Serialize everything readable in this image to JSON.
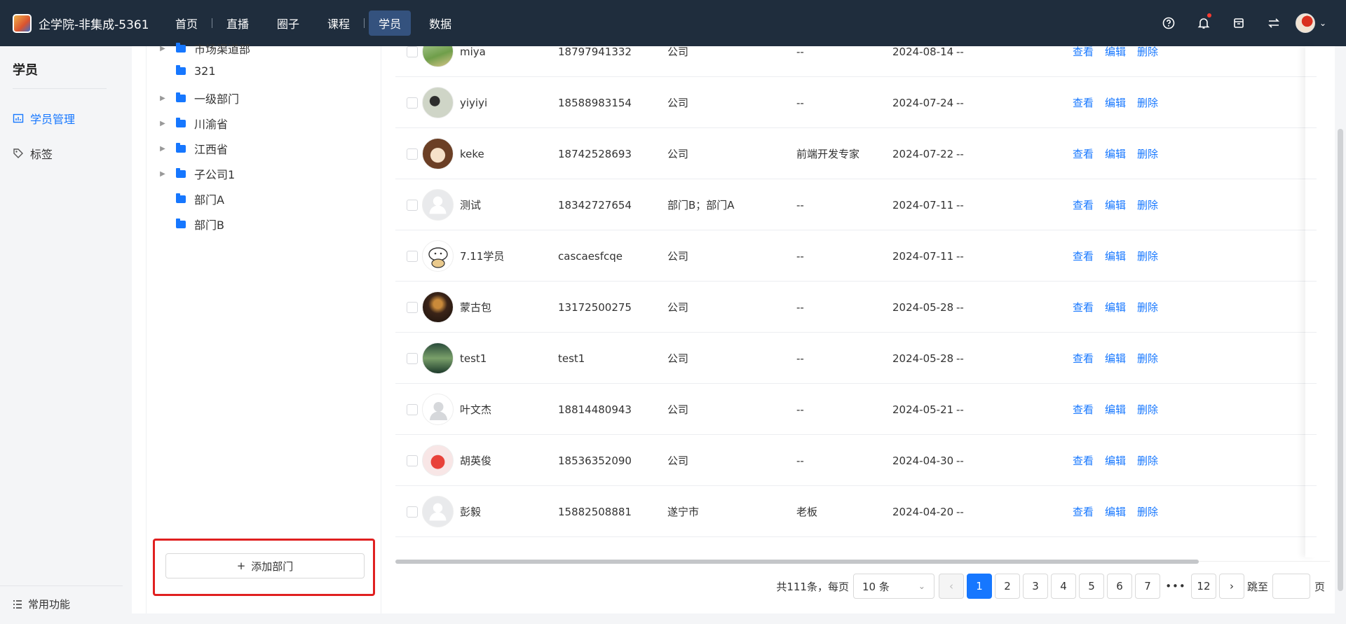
{
  "header": {
    "brand": "企学院-非集成-5361",
    "nav": [
      "首页",
      "直播",
      "圈子",
      "课程",
      "学员",
      "数据"
    ],
    "active_nav": "学员"
  },
  "sidebar": {
    "title": "学员",
    "items": [
      {
        "label": "学员管理",
        "icon": "chart-icon",
        "active": true
      },
      {
        "label": "标签",
        "icon": "tag-icon",
        "active": false
      }
    ],
    "bottom": "常用功能"
  },
  "tree": {
    "nodes": [
      {
        "label": "市场渠道部",
        "expandable": true
      },
      {
        "label": "321",
        "expandable": false
      },
      {
        "label": "一级部门",
        "expandable": true
      },
      {
        "label": "川渝省",
        "expandable": true
      },
      {
        "label": "江西省",
        "expandable": true
      },
      {
        "label": "子公司1",
        "expandable": true
      },
      {
        "label": "部门A",
        "expandable": false
      },
      {
        "label": "部门B",
        "expandable": false
      }
    ],
    "add_button": "添加部门",
    "add_symbol": "+"
  },
  "table": {
    "actions": [
      "查看",
      "编辑",
      "删除"
    ],
    "rows": [
      {
        "name": "miya",
        "phone": "18797941332",
        "dept": "公司",
        "title": "--",
        "date": "2024-08-14",
        "extra": "--",
        "avatar": "av-miya"
      },
      {
        "name": "yiyiyi",
        "phone": "18588983154",
        "dept": "公司",
        "title": "--",
        "date": "2024-07-24",
        "extra": "--",
        "avatar": "av-yiyiyi"
      },
      {
        "name": "keke",
        "phone": "18742528693",
        "dept": "公司",
        "title": "前端开发专家",
        "date": "2024-07-22",
        "extra": "--",
        "avatar": "av-keke"
      },
      {
        "name": "测试",
        "phone": "18342727654",
        "dept": "部门B；部门A",
        "title": "--",
        "date": "2024-07-11",
        "extra": "--",
        "avatar": "av-default"
      },
      {
        "name": "7.11学员",
        "phone": "cascaesfcqe",
        "dept": "公司",
        "title": "--",
        "date": "2024-07-11",
        "extra": "--",
        "avatar": "av-dog"
      },
      {
        "name": "蒙古包",
        "phone": "13172500275",
        "dept": "公司",
        "title": "--",
        "date": "2024-05-28",
        "extra": "--",
        "avatar": "av-mg"
      },
      {
        "name": "test1",
        "phone": "test1",
        "dept": "公司",
        "title": "--",
        "date": "2024-05-28",
        "extra": "--",
        "avatar": "av-test1"
      },
      {
        "name": "叶文杰",
        "phone": "18814480943",
        "dept": "公司",
        "title": "--",
        "date": "2024-05-21",
        "extra": "--",
        "avatar": "av-ye"
      },
      {
        "name": "胡英俊",
        "phone": "18536352090",
        "dept": "公司",
        "title": "--",
        "date": "2024-04-30",
        "extra": "--",
        "avatar": "av-hu"
      },
      {
        "name": "彭毅",
        "phone": "15882508881",
        "dept": "遂宁市",
        "title": "老板",
        "date": "2024-04-20",
        "extra": "--",
        "avatar": "av-default"
      }
    ]
  },
  "pagination": {
    "total_text": "共111条，每页",
    "page_size": "10 条",
    "pages": [
      "1",
      "2",
      "3",
      "4",
      "5",
      "6",
      "7"
    ],
    "ellipsis": "•••",
    "last": "12",
    "current": "1",
    "jump_label": "跳至",
    "page_suffix": "页"
  }
}
